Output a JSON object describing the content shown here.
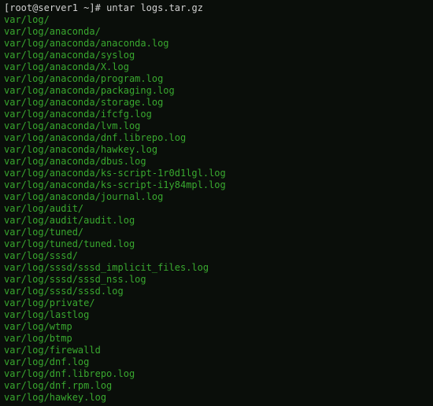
{
  "prompt": {
    "open_bracket": "[",
    "user": "root",
    "at": "@",
    "host": "server1",
    "path": " ~",
    "close_bracket": "]",
    "hash": "# ",
    "command": "untar logs.tar.gz"
  },
  "output": [
    "var/log/",
    "var/log/anaconda/",
    "var/log/anaconda/anaconda.log",
    "var/log/anaconda/syslog",
    "var/log/anaconda/X.log",
    "var/log/anaconda/program.log",
    "var/log/anaconda/packaging.log",
    "var/log/anaconda/storage.log",
    "var/log/anaconda/ifcfg.log",
    "var/log/anaconda/lvm.log",
    "var/log/anaconda/dnf.librepo.log",
    "var/log/anaconda/hawkey.log",
    "var/log/anaconda/dbus.log",
    "var/log/anaconda/ks-script-1r0d1lgl.log",
    "var/log/anaconda/ks-script-i1y84mpl.log",
    "var/log/anaconda/journal.log",
    "var/log/audit/",
    "var/log/audit/audit.log",
    "var/log/tuned/",
    "var/log/tuned/tuned.log",
    "var/log/sssd/",
    "var/log/sssd/sssd_implicit_files.log",
    "var/log/sssd/sssd_nss.log",
    "var/log/sssd/sssd.log",
    "var/log/private/",
    "var/log/lastlog",
    "var/log/wtmp",
    "var/log/btmp",
    "var/log/firewalld",
    "var/log/dnf.log",
    "var/log/dnf.librepo.log",
    "var/log/dnf.rpm.log",
    "var/log/hawkey.log"
  ]
}
